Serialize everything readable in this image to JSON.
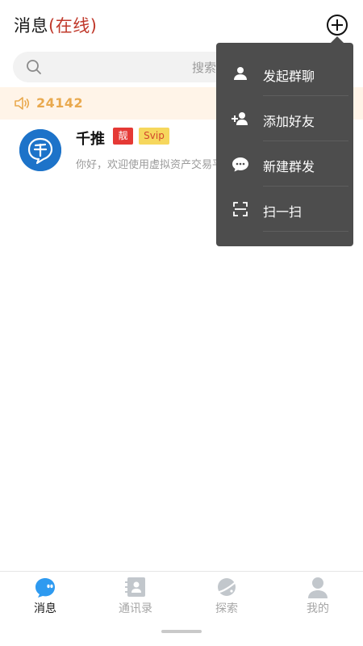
{
  "header": {
    "title": "消息",
    "status": "(在线)",
    "add_icon": "plus-circle-icon"
  },
  "search": {
    "placeholder": "搜索"
  },
  "notice": {
    "text": "24142",
    "icon": "speaker-icon",
    "color": "#e9a94e"
  },
  "conversations": [
    {
      "name": "千推",
      "badges": [
        "靓",
        "Svip"
      ],
      "preview": "你好，欢迎使用虚拟资产交易平台",
      "avatar_icon": "qiantui-logo",
      "avatar_color": "#1d73c9"
    }
  ],
  "menu": {
    "items": [
      {
        "label": "发起群聊",
        "icon": "person-icon"
      },
      {
        "label": "添加好友",
        "icon": "add-friend-icon"
      },
      {
        "label": "新建群发",
        "icon": "chat-bubble-icon"
      },
      {
        "label": "扫一扫",
        "icon": "scan-icon"
      }
    ],
    "background": "#4d4d4d"
  },
  "tabbar": {
    "tabs": [
      {
        "label": "消息",
        "icon": "message-icon",
        "active": true
      },
      {
        "label": "通讯录",
        "icon": "contacts-icon",
        "active": false
      },
      {
        "label": "探索",
        "icon": "planet-icon",
        "active": false
      },
      {
        "label": "我的",
        "icon": "profile-icon",
        "active": false
      }
    ],
    "active_color": "#2e9af0",
    "inactive_color": "#c2c7cc"
  }
}
